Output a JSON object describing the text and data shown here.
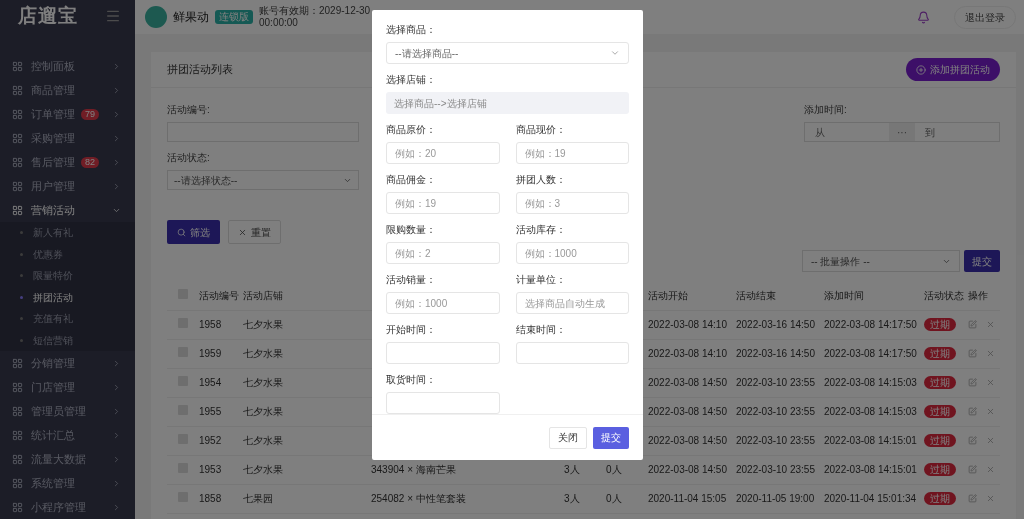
{
  "sidebar": {
    "logo": "店遛宝",
    "items": [
      {
        "label": "控制面板",
        "expanded": false
      },
      {
        "label": "商品管理",
        "expanded": false
      },
      {
        "label": "订单管理",
        "badge": "79",
        "expanded": false
      },
      {
        "label": "采购管理",
        "expanded": false
      },
      {
        "label": "售后管理",
        "badge": "82",
        "expanded": false
      },
      {
        "label": "用户管理",
        "expanded": false
      },
      {
        "label": "营销活动",
        "expanded": true,
        "children": [
          {
            "label": "新人有礼",
            "selected": false
          },
          {
            "label": "优惠券",
            "selected": false
          },
          {
            "label": "限量特价",
            "selected": false
          },
          {
            "label": "拼团活动",
            "selected": true
          },
          {
            "label": "充值有礼",
            "selected": false
          },
          {
            "label": "短信营销",
            "selected": false
          }
        ]
      },
      {
        "label": "分销管理",
        "expanded": false
      },
      {
        "label": "门店管理",
        "expanded": false
      },
      {
        "label": "管理员管理",
        "expanded": false
      },
      {
        "label": "统计汇总",
        "expanded": false
      },
      {
        "label": "流量大数据",
        "expanded": false
      },
      {
        "label": "系统管理",
        "expanded": false
      },
      {
        "label": "小程序管理",
        "expanded": false
      }
    ]
  },
  "header": {
    "shop_name": "鲜果动",
    "edition": "连锁版",
    "expiry": "账号有效期：2029-12-30 00:00:00",
    "logout": "退出登录"
  },
  "page": {
    "title": "拼团活动列表",
    "add_button": "添加拼团活动",
    "filters": {
      "id_label": "活动编号:",
      "time_label": "添加时间:",
      "time_from": "从",
      "time_sep": "···",
      "time_to": "到",
      "status_label": "活动状态:",
      "status_placeholder": "--请选择状态--"
    },
    "search_button": "筛选",
    "reset_button": "重置",
    "batch_placeholder": "-- 批量操作 --",
    "batch_submit": "提交",
    "table": {
      "all_selected": false,
      "columns": [
        "活动编号",
        "活动店铺",
        "活动开始",
        "活动结束",
        "添加时间",
        "活动状态",
        "操作"
      ],
      "rows": [
        {
          "selected": false,
          "id": "1958",
          "shop": "七夕水果",
          "start": "2022-03-08 14:10",
          "end": "2022-03-16 14:50",
          "added": "2022-03-08 14:17:50",
          "status": "过期"
        },
        {
          "selected": false,
          "id": "1959",
          "shop": "七夕水果",
          "start": "2022-03-08 14:10",
          "end": "2022-03-16 14:50",
          "added": "2022-03-08 14:17:50",
          "status": "过期"
        },
        {
          "selected": false,
          "id": "1954",
          "shop": "七夕水果",
          "start": "2022-03-08 14:50",
          "end": "2022-03-10 23:55",
          "added": "2022-03-08 14:15:03",
          "status": "过期"
        },
        {
          "selected": false,
          "id": "1955",
          "shop": "七夕水果",
          "start": "2022-03-08 14:50",
          "end": "2022-03-10 23:55",
          "added": "2022-03-08 14:15:03",
          "status": "过期"
        },
        {
          "selected": false,
          "id": "1952",
          "shop": "七夕水果",
          "start": "2022-03-08 14:50",
          "end": "2022-03-10 23:55",
          "added": "2022-03-08 14:15:01",
          "status": "过期"
        },
        {
          "selected": false,
          "id": "1953",
          "shop": "七夕水果",
          "product": "343904 × 海南芒果",
          "group_size": "3人",
          "joined": "0人",
          "start": "2022-03-08 14:50",
          "end": "2022-03-10 23:55",
          "added": "2022-03-08 14:15:01",
          "status": "过期"
        },
        {
          "selected": false,
          "id": "1858",
          "shop": "七果园",
          "product": "254082 × 中性笔套装",
          "group_size": "3人",
          "joined": "0人",
          "start": "2020-11-04 15:05",
          "end": "2020-11-05 19:00",
          "added": "2020-11-04 15:01:34",
          "status": "过期"
        }
      ]
    }
  },
  "dialog": {
    "fields": [
      {
        "kind": "select",
        "label": "选择商品：",
        "placeholder": "--请选择商品--"
      },
      {
        "kind": "readonly",
        "label": "选择店铺：",
        "placeholder": "选择商品-->选择店铺"
      },
      {
        "kind": "input",
        "label": "商品原价：",
        "placeholder": "例如：20"
      },
      {
        "kind": "input",
        "label": "商品现价：",
        "placeholder": "例如：19"
      },
      {
        "kind": "input",
        "label": "商品佣金：",
        "placeholder": "例如：19"
      },
      {
        "kind": "input",
        "label": "拼团人数：",
        "placeholder": "例如：3"
      },
      {
        "kind": "input",
        "label": "限购数量：",
        "placeholder": "例如：2"
      },
      {
        "kind": "input",
        "label": "活动库存：",
        "placeholder": "例如：1000"
      },
      {
        "kind": "input",
        "label": "活动销量：",
        "placeholder": "例如：1000"
      },
      {
        "kind": "input",
        "label": "计量单位：",
        "placeholder": "选择商品自动生成"
      },
      {
        "kind": "input",
        "label": "开始时间："
      },
      {
        "kind": "input",
        "label": "结束时间："
      },
      {
        "kind": "input",
        "label": "取货时间："
      }
    ],
    "close_button": "关闭",
    "submit_button": "提交"
  }
}
